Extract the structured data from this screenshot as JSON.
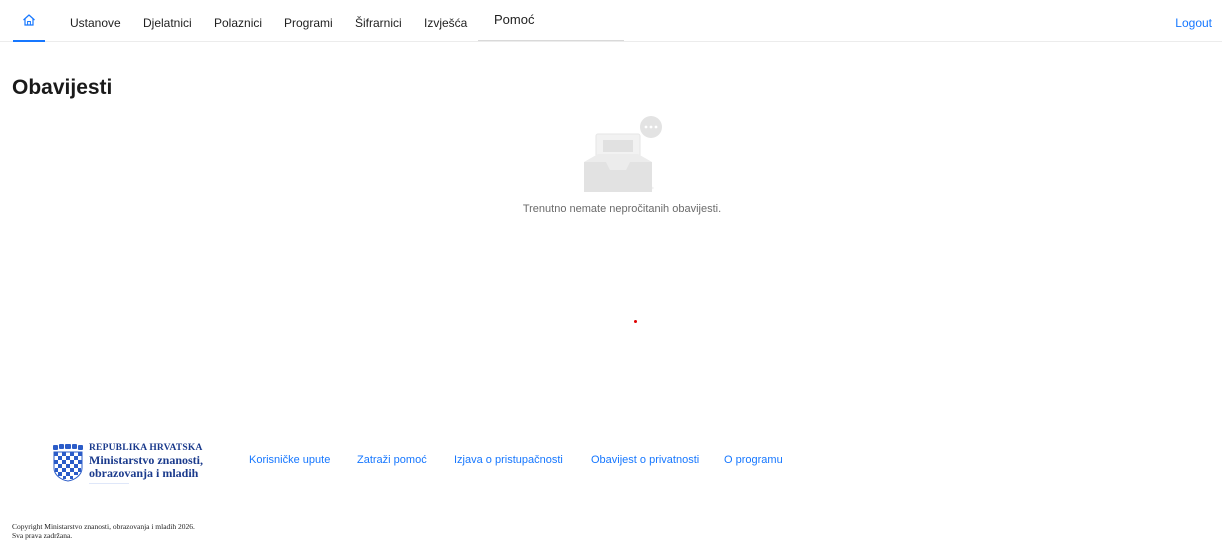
{
  "nav": {
    "home_icon": "home-icon",
    "items": [
      {
        "label": "Ustanove"
      },
      {
        "label": "Djelatnici"
      },
      {
        "label": "Polaznici"
      },
      {
        "label": "Programi"
      },
      {
        "label": "Šifrarnici"
      },
      {
        "label": "Izvješća"
      },
      {
        "label": "Pomoć"
      }
    ],
    "logout": "Logout",
    "accent_color": "#1677ff"
  },
  "main": {
    "title": "Obavijesti",
    "empty_icon": "empty-inbox-icon",
    "empty_message": "Trenutno nemate nepročitanih obavijesti."
  },
  "footer": {
    "logo": {
      "line1": "REPUBLIKA HRVATSKA",
      "line2": "Ministarstvo znanosti,",
      "line3": "obrazovanja i mladih",
      "line4": "........................................"
    },
    "links": [
      {
        "label": "Korisničke upute"
      },
      {
        "label": "Zatraži pomoć"
      },
      {
        "label": "Izjava o pristupačnosti"
      },
      {
        "label": "Obavijest o privatnosti"
      },
      {
        "label": "O programu"
      }
    ],
    "copyright_line1": "Copyright Ministarstvo znanosti, obrazovanja i mladih 2026.",
    "copyright_line2": "Sva prava zadržana."
  }
}
